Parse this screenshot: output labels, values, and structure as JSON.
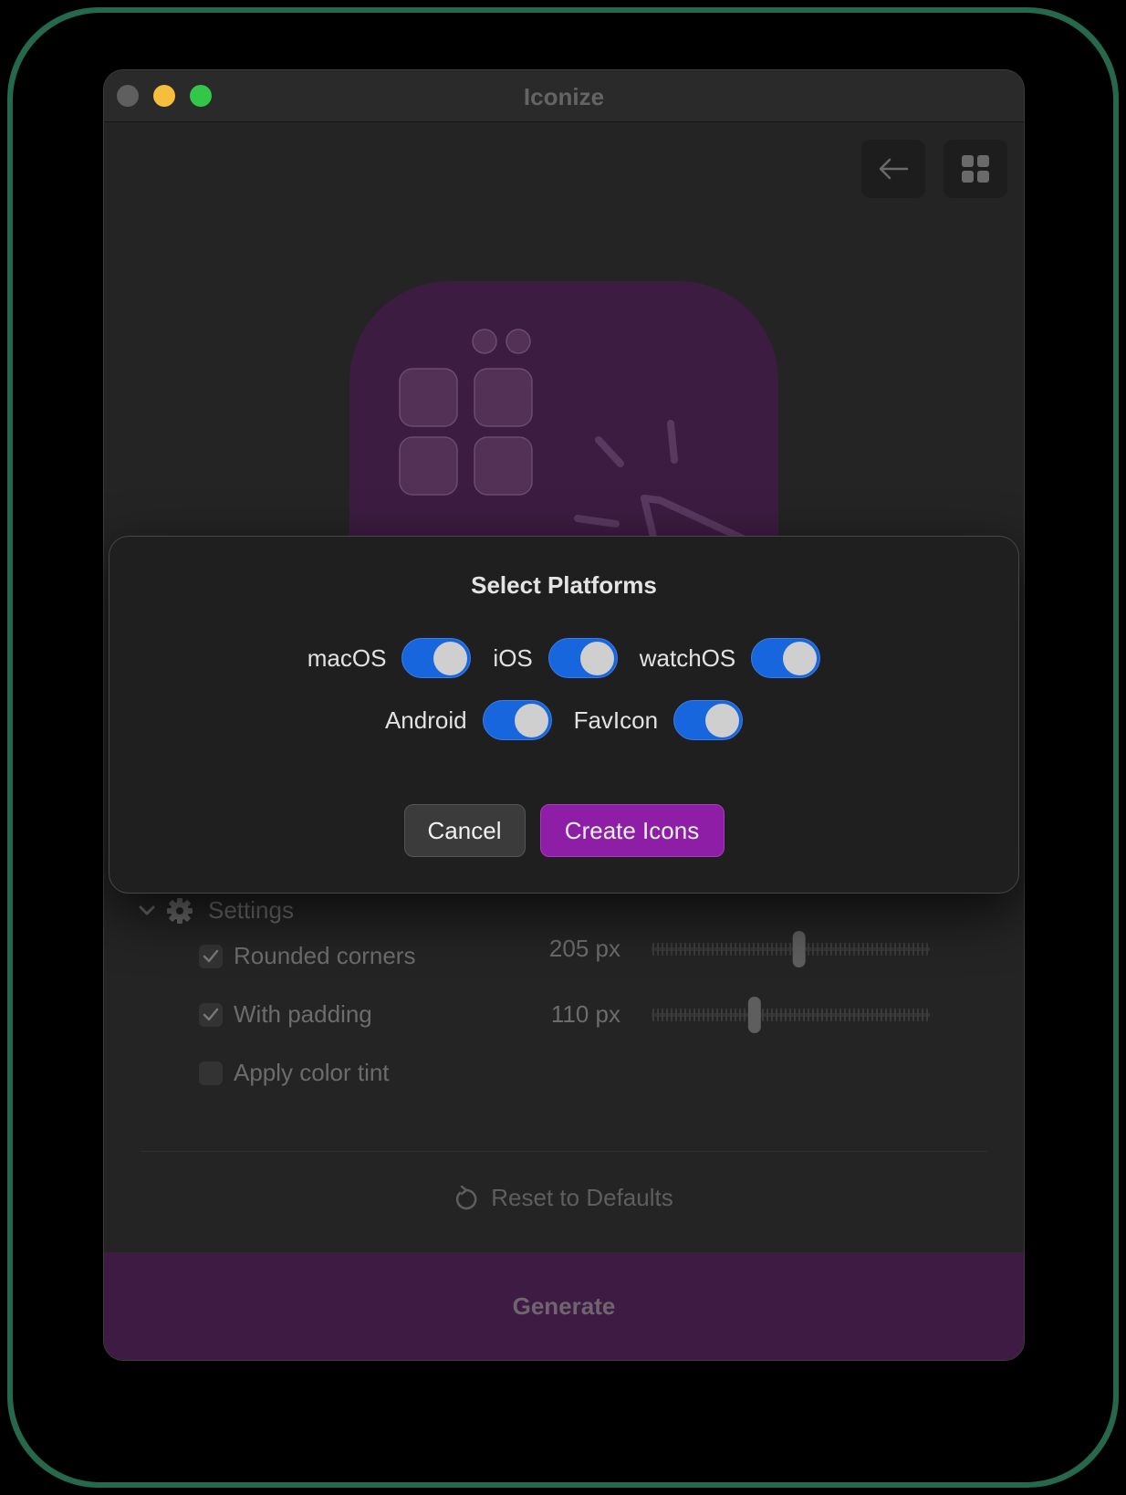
{
  "window": {
    "title": "Iconize"
  },
  "toolbar": {
    "back_icon": "arrow-left-icon",
    "grid_icon": "grid-icon"
  },
  "settings": {
    "section_label": "Settings",
    "options": [
      {
        "label": "Rounded corners",
        "checked": true,
        "value_label": "205 px",
        "slider_level": 0.53
      },
      {
        "label": "With padding",
        "checked": true,
        "value_label": "110 px",
        "slider_level": 0.37
      },
      {
        "label": "Apply color tint",
        "checked": false
      }
    ],
    "reset_label": "Reset to Defaults"
  },
  "generate": {
    "label": "Generate"
  },
  "modal": {
    "title": "Select Platforms",
    "platforms_row1": [
      {
        "label": "macOS",
        "on": true
      },
      {
        "label": "iOS",
        "on": true
      },
      {
        "label": "watchOS",
        "on": true
      }
    ],
    "platforms_row2": [
      {
        "label": "Android",
        "on": true
      },
      {
        "label": "FavIcon",
        "on": true
      }
    ],
    "cancel_label": "Cancel",
    "create_label": "Create Icons"
  },
  "colors": {
    "accent": "#8f1ea6",
    "toggle_on": "#1766de",
    "icon_bg": "#3d1c42"
  }
}
